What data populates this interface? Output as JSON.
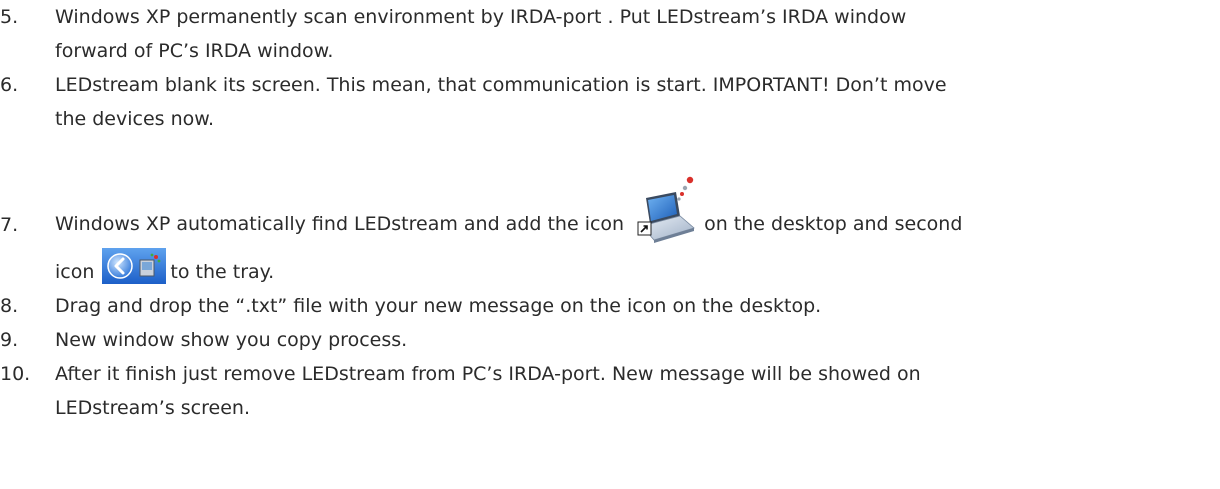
{
  "items": [
    {
      "number": "5.",
      "lines": [
        "Windows XP permanently scan environment by IRDA-port .  Put LEDstream’s  IRDA window",
        "forward of PC’s IRDA window."
      ]
    },
    {
      "number": "6.",
      "lines": [
        "LEDstream blank its screen. This mean, that communication is start. IMPORTANT! Don’t move",
        "the devices now."
      ]
    },
    {
      "number": "7.",
      "part1": "Windows XP automatically find LEDstream and add the icon",
      "part2": "on the desktop and second",
      "part3": "icon",
      "part4": "to the tray.",
      "icons": [
        "laptop-shortcut-icon",
        "irda-tray-icon"
      ]
    },
    {
      "number": "8.",
      "lines": [
        "Drag and drop the “.txt” file with your new message on the icon on the desktop."
      ]
    },
    {
      "number": "9.",
      "lines": [
        "New window show you copy process."
      ]
    },
    {
      "number": "10.",
      "lines": [
        "After it finish just remove LEDstream from PC’s IRDA-port. New message will be showed on",
        "LEDstream’s screen."
      ]
    }
  ],
  "colors": {
    "text": "#2b2b2b",
    "tray_blue": "#1f6fd6",
    "laptop_screen": "#2f7fd8",
    "signal_red": "#d9302b"
  }
}
